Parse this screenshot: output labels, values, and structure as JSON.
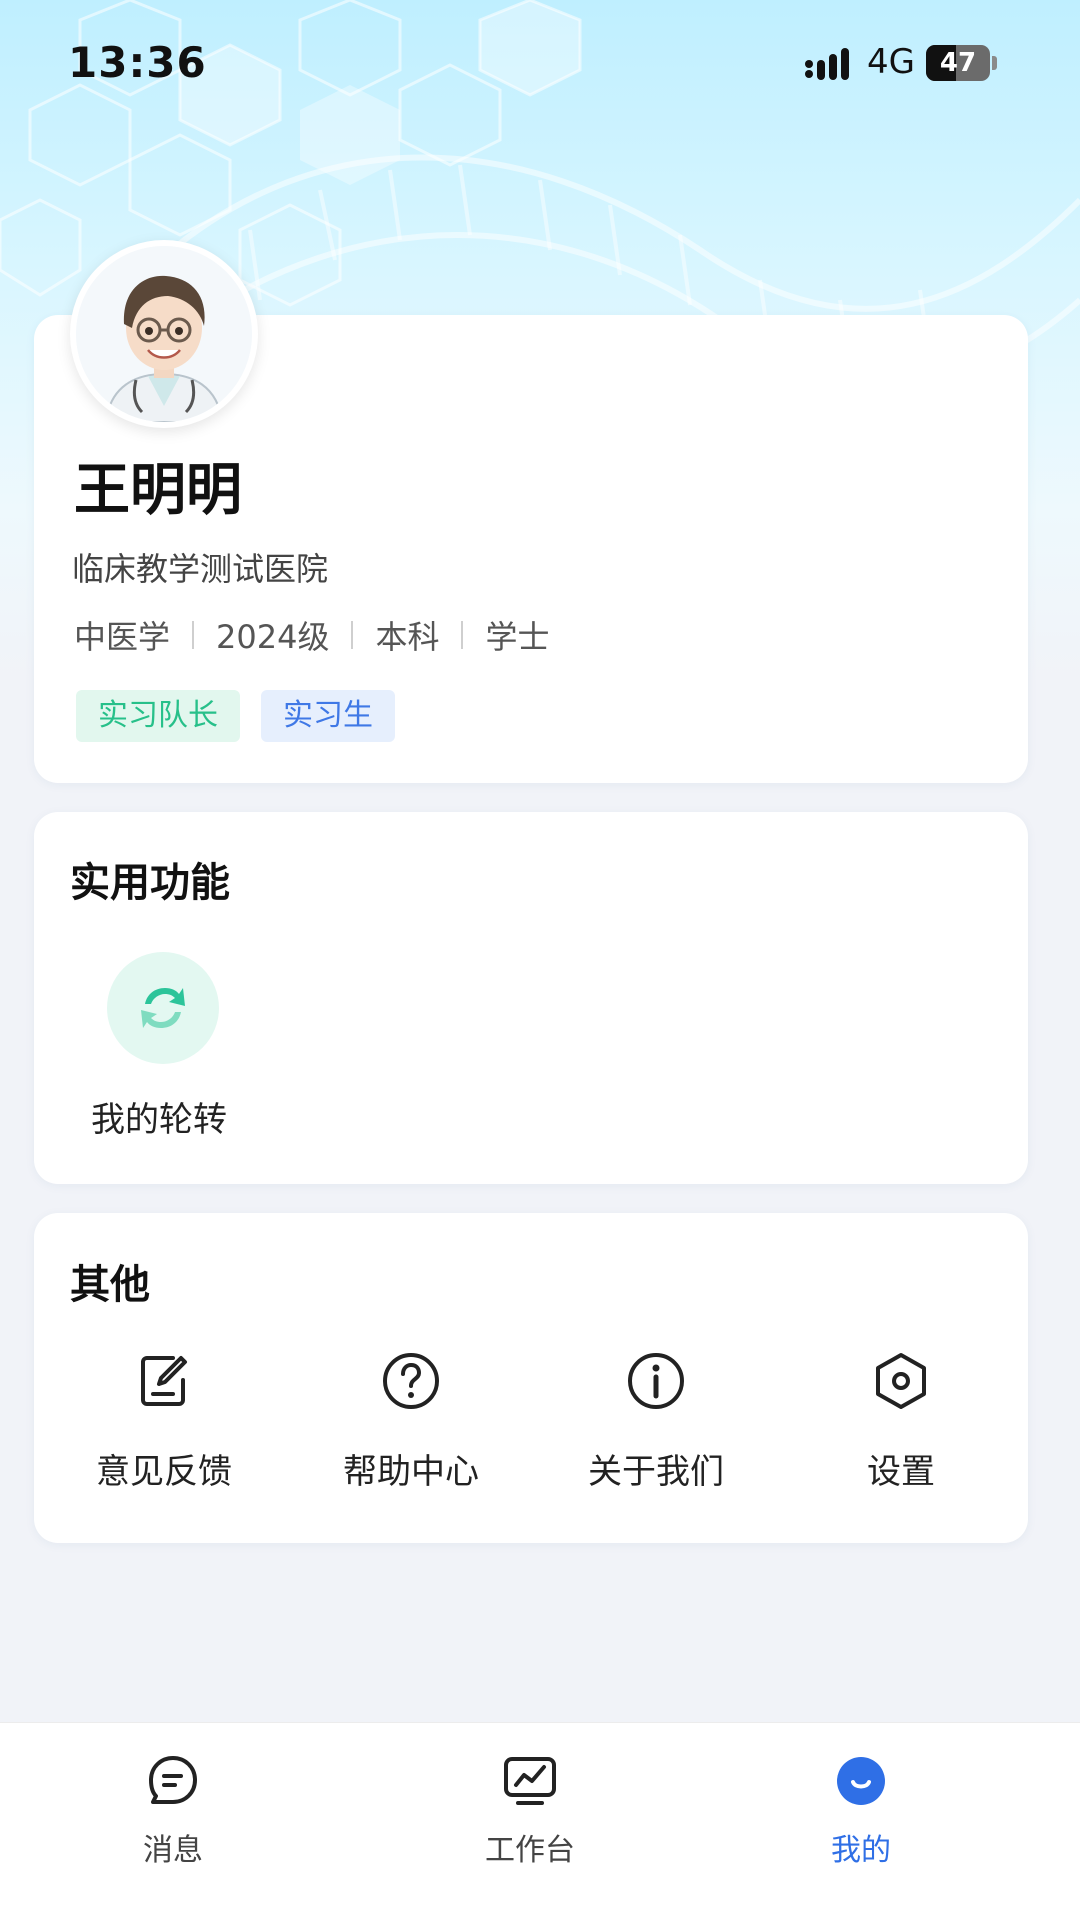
{
  "status_bar": {
    "time": "13:36",
    "network": "4G",
    "battery": "47",
    "battery_level": 0.47
  },
  "profile": {
    "name": "王明明",
    "hospital": "临床教学测试医院",
    "major": "中医学",
    "grade": "2024级",
    "degree_level": "本科",
    "degree": "学士",
    "tags": [
      "实习队长",
      "实习生"
    ]
  },
  "utilities": {
    "title": "实用功能",
    "items": [
      {
        "label": "我的轮转",
        "icon": "rotate-icon"
      }
    ]
  },
  "others": {
    "title": "其他",
    "items": [
      {
        "label": "意见反馈",
        "icon": "feedback-icon"
      },
      {
        "label": "帮助中心",
        "icon": "help-icon"
      },
      {
        "label": "关于我们",
        "icon": "info-icon"
      },
      {
        "label": "设置",
        "icon": "settings-icon"
      }
    ]
  },
  "tabbar": {
    "items": [
      {
        "label": "消息",
        "icon": "message-icon"
      },
      {
        "label": "工作台",
        "icon": "workbench-icon"
      },
      {
        "label": "我的",
        "icon": "profile-icon"
      }
    ],
    "active": "我的"
  },
  "colors": {
    "accent": "#2f6fe6",
    "leader_tag": "#27c08a",
    "intern_tag": "#3f78e6",
    "rotate_icon": "#2cc49a"
  }
}
